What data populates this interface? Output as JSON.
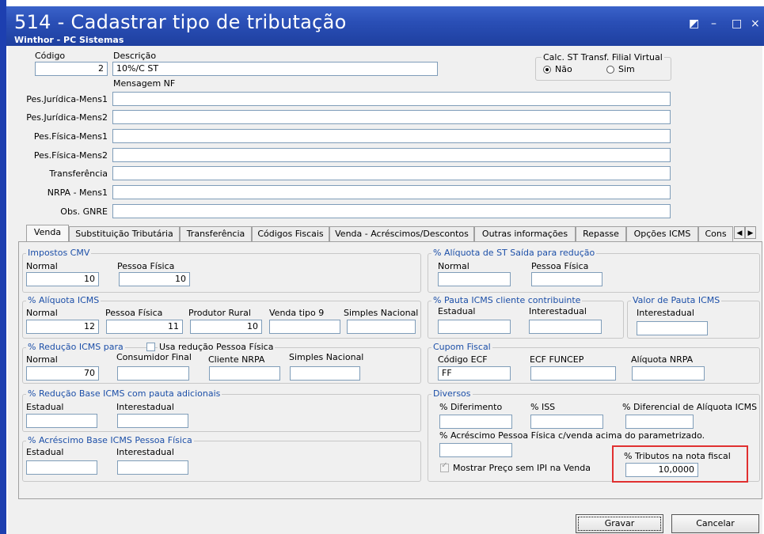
{
  "window": {
    "title": "514 - Cadastrar tipo de tributação",
    "subtitle": "Winthor - PC Sistemas",
    "controls": [
      "◩",
      "–",
      "□",
      "×"
    ]
  },
  "header": {
    "codigo_label": "Código",
    "codigo_value": "2",
    "descricao_label": "Descrição",
    "descricao_value": "10%/C ST",
    "calc_st_label": "Calc. ST Transf. Filial Virtual",
    "radio_nao": "Não",
    "radio_sim": "Sim",
    "mensagem_nf_label": "Mensagem NF",
    "messages": [
      {
        "label": "Pes.Jurídica-Mens1",
        "value": ""
      },
      {
        "label": "Pes.Jurídica-Mens2",
        "value": ""
      },
      {
        "label": "Pes.Física-Mens1",
        "value": ""
      },
      {
        "label": "Pes.Física-Mens2",
        "value": ""
      },
      {
        "label": "Transferência",
        "value": ""
      },
      {
        "label": "NRPA - Mens1",
        "value": ""
      },
      {
        "label": "Obs. GNRE",
        "value": ""
      }
    ]
  },
  "tabs": [
    "Venda",
    "Substituição Tributária",
    "Transferência",
    "Códigos Fiscais",
    "Venda - Acréscimos/Descontos",
    "Outras informações",
    "Repasse",
    "Opções ICMS",
    "Cons"
  ],
  "venda": {
    "impostos_cmv": {
      "title": "Impostos CMV",
      "normal_label": "Normal",
      "normal": "10",
      "pf_label": "Pessoa Física",
      "pf": "10"
    },
    "aliquota_icms": {
      "title": "% Alíquota ICMS",
      "normal_label": "Normal",
      "normal": "12",
      "pf_label": "Pessoa Física",
      "pf": "11",
      "prod_label": "Produtor Rural",
      "prod": "10",
      "venda9_label": "Venda tipo 9",
      "venda9": "",
      "simples_label": "Simples Nacional",
      "simples": ""
    },
    "reducao_icms": {
      "title": "% Redução ICMS para",
      "usa_pf_label": "Usa redução Pessoa Física",
      "normal_label": "Normal",
      "normal": "70",
      "cf_label": "Consumidor Final",
      "cf": "",
      "nrpa_label": "Cliente NRPA",
      "nrpa": "",
      "simples_label": "Simples Nacional",
      "simples": ""
    },
    "reducao_base": {
      "title": "% Redução Base ICMS com pauta adicionais",
      "estadual_label": "Estadual",
      "estadual": "",
      "inter_label": "Interestadual",
      "inter": ""
    },
    "acrescimo_base": {
      "title": "% Acréscimo Base ICMS Pessoa Física",
      "estadual_label": "Estadual",
      "estadual": "",
      "inter_label": "Interestadual",
      "inter": ""
    },
    "aliquota_st": {
      "title": "% Alíquota de ST Saída para redução",
      "normal_label": "Normal",
      "normal": "",
      "pf_label": "Pessoa Física",
      "pf": ""
    },
    "pauta_icms": {
      "title": "% Pauta ICMS cliente contribuinte",
      "estadual_label": "Estadual",
      "estadual": "",
      "inter_label": "Interestadual",
      "inter": ""
    },
    "valor_pauta": {
      "title": "Valor de Pauta ICMS",
      "inter_label": "Interestadual",
      "inter": ""
    },
    "cupom_fiscal": {
      "title": "Cupom Fiscal",
      "ecf_label": "Código ECF",
      "ecf": "FF",
      "funcep_label": "ECF FUNCEP",
      "funcep": "",
      "nrpa_label": "Alíquota NRPA",
      "nrpa": ""
    },
    "diversos": {
      "title": "Diversos",
      "diferimento_label": "% Diferimento",
      "diferimento": "",
      "iss_label": "% ISS",
      "iss": "",
      "difal_label": "% Diferencial de Alíquota ICMS",
      "difal": "",
      "acrescimo_pf_label": "% Acréscimo Pessoa Física c/venda acima do parametrizado.",
      "acrescimo_pf": "",
      "mostrar_preco_label": "Mostrar Preço sem IPI na Venda",
      "tributos_label": "% Tributos na nota fiscal",
      "tributos": "10,0000"
    }
  },
  "buttons": {
    "gravar": "Gravar",
    "cancelar": "Cancelar"
  },
  "colors": {
    "titlebar": "#2a4fb6",
    "group_title": "#1c4fa8",
    "highlight": "#e03030"
  }
}
